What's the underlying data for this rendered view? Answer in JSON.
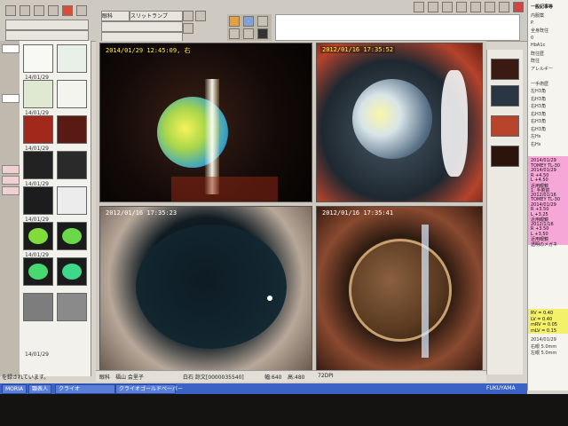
{
  "toolbar": {
    "dropdown1": "眼科",
    "dropdown2": "スリットランプ",
    "input1": ""
  },
  "thumbnails": [
    {
      "date": "14/01/29"
    },
    {
      "date": "14/01/29"
    },
    {
      "date": "14/01/29"
    },
    {
      "date": "14/01/29"
    },
    {
      "date": "14/01/29"
    },
    {
      "date": "14/01/29"
    },
    {
      "date": "14/01/29"
    }
  ],
  "images": [
    {
      "stamp": "2014/01/29 12:45:09, 右"
    },
    {
      "stamp": "2012/01/16 17:35:52"
    },
    {
      "stamp": "2012/01/16 17:35:23"
    },
    {
      "stamp": "2012/01/16 17:35:41"
    }
  ],
  "status": {
    "label1": "眼科",
    "patient": "福山 会里子",
    "field": "白石 諒文[0000035540]",
    "width": "幅:640",
    "height": "高:480",
    "dpi": "72DPI",
    "left_text": "を録されています。"
  },
  "right_panel": {
    "title": "一般記事等",
    "lines": [
      "内服薬",
      "P.",
      "全身既往",
      "0",
      "HbA1c",
      "既往歴",
      "既往",
      "アレルギー",
      "",
      "一手術歴",
      "左H3角",
      "右H3角",
      "右H3角",
      "右H3角",
      "右H3角",
      "右H3角",
      "左Hs",
      "右Hs"
    ],
    "highlight_lines": [
      "2014/01/29",
      "TOMEY TL-30",
      "2014/01/29",
      "R +4.50",
      "L +4.50",
      "近用眼鏡",
      "1: 手術前",
      "2012/01/16",
      "TOMEY TL-30",
      "2014/01/29",
      "R +3.50",
      "L +3.25",
      "近用眼鏡",
      "2012/1/16",
      "R +3.50",
      "L +3.50",
      "近用眼鏡",
      "透明のメガネ"
    ],
    "yellow_lines": [
      "RV = 0.40",
      "LV = 0.40",
      "mRV = 0.05",
      "mLV = 0.15"
    ],
    "bottom_lines": [
      "2014/01/29",
      "右眼 5.0mm",
      "左眼 5.0mm"
    ]
  },
  "taskbar": {
    "items": [
      "MORIA",
      "顕表人",
      "クライオ",
      "クライオゴールドベーパー"
    ],
    "tray": "FUKUYAMA"
  }
}
